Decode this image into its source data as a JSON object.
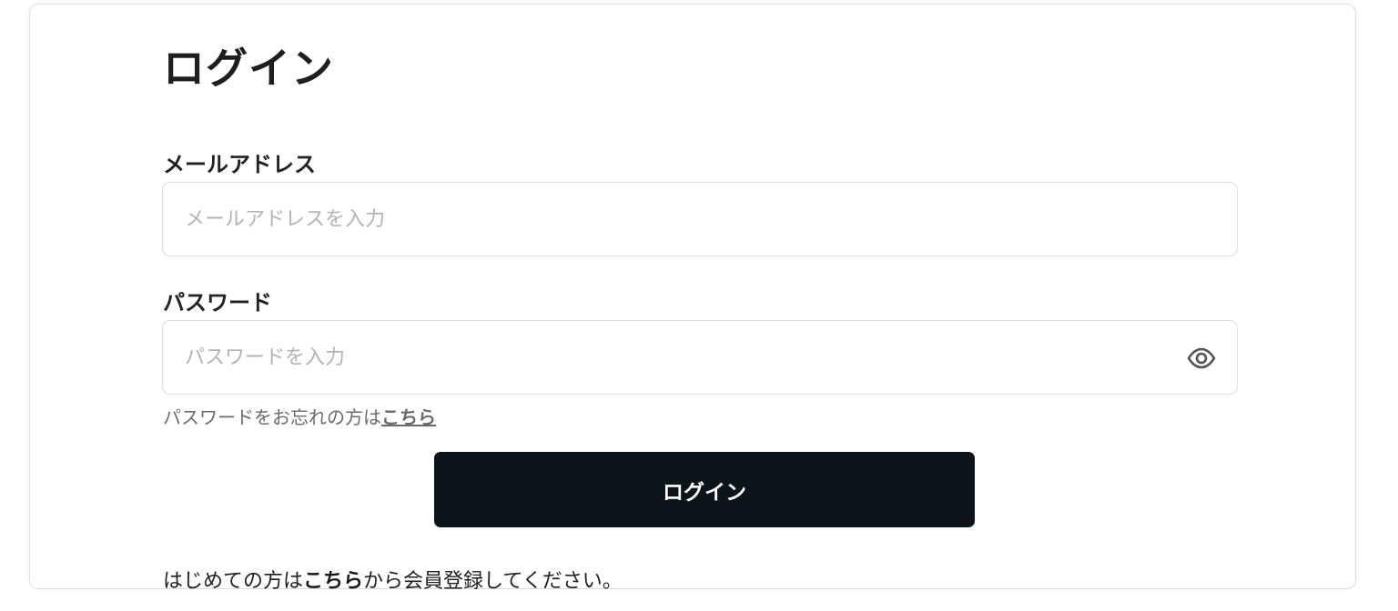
{
  "page": {
    "title": "ログイン"
  },
  "email": {
    "label": "メールアドレス",
    "placeholder": "メールアドレスを入力",
    "value": ""
  },
  "password": {
    "label": "パスワード",
    "placeholder": "パスワードを入力",
    "value": "",
    "toggle_icon": "eye-icon"
  },
  "forgot": {
    "text": "パスワードをお忘れの方は",
    "link": "こちら"
  },
  "login_button": {
    "label": "ログイン",
    "bg_color": "#0b1419"
  },
  "register": {
    "prefix": "はじめての方は",
    "link": "こちら",
    "suffix": "から会員登録してください。"
  }
}
